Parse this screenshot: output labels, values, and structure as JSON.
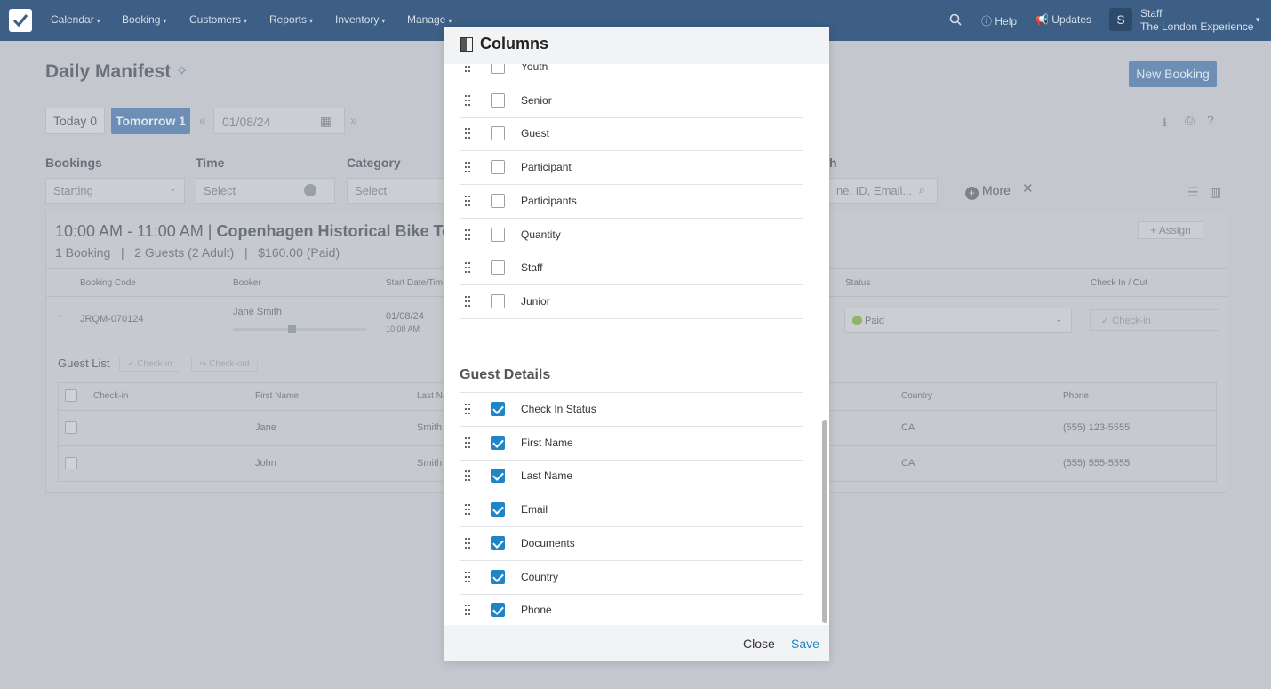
{
  "nav": {
    "items": [
      {
        "label": "Calendar"
      },
      {
        "label": "Booking"
      },
      {
        "label": "Customers"
      },
      {
        "label": "Reports"
      },
      {
        "label": "Inventory"
      },
      {
        "label": "Manage"
      }
    ],
    "help": "Help",
    "updates": "Updates",
    "avatar_initial": "S",
    "user_name": "Staff",
    "company": "The London Experience"
  },
  "page": {
    "title": "Daily Manifest",
    "new_booking": "New Booking",
    "today": "Today 0",
    "tomorrow": "Tomorrow 1",
    "date_value": "01/08/24"
  },
  "filters": {
    "bookings_label": "Bookings",
    "bookings_value": "Starting",
    "time_label": "Time",
    "time_placeholder": "Select",
    "category_label": "Category",
    "category_placeholder": "Select",
    "search_label_fragment": "h",
    "search_placeholder_fragment": "ne, ID, Email...",
    "more": "More"
  },
  "tour": {
    "time_range": "10:00 AM - 11:00 AM | ",
    "name": "Copenhagen Historical Bike Tour",
    "summary": "1 Booking   |   2 Guests (2 Adult)   |   $160.00 (Paid)",
    "assign": "Assign",
    "headers": {
      "booking_code": "Booking Code",
      "booker": "Booker",
      "start": "Start Date/Tim",
      "status": "Status",
      "check_in_out": "Check In / Out"
    },
    "row": {
      "code": "JRQM-070124",
      "booker": "Jane Smith",
      "start_date": "01/08/24",
      "start_time": "10:00 AM",
      "status": "Paid",
      "check_in": "Check-in"
    }
  },
  "guest_list": {
    "title": "Guest List",
    "check_in_btn": "Check-in",
    "check_out_btn": "Check-out",
    "headers": {
      "check_in": "Check-in",
      "first_name": "First Name",
      "last_name": "Last Na",
      "country": "Country",
      "phone": "Phone"
    },
    "rows": [
      {
        "first": "Jane",
        "last": "Smith",
        "country": "CA",
        "phone": "(555) 123-5555"
      },
      {
        "first": "John",
        "last": "Smith",
        "country": "CA",
        "phone": "(555) 555-5555"
      }
    ]
  },
  "modal": {
    "title": "Columns",
    "booking_columns": [
      {
        "label": "Youth",
        "checked": false
      },
      {
        "label": "Senior",
        "checked": false
      },
      {
        "label": "Guest",
        "checked": false
      },
      {
        "label": "Participant",
        "checked": false
      },
      {
        "label": "Participants",
        "checked": false
      },
      {
        "label": "Quantity",
        "checked": false
      },
      {
        "label": "Staff",
        "checked": false
      },
      {
        "label": "Junior",
        "checked": false
      }
    ],
    "guest_section_title": "Guest Details",
    "guest_columns": [
      {
        "label": "Check In Status",
        "checked": true
      },
      {
        "label": "First Name",
        "checked": true
      },
      {
        "label": "Last Name",
        "checked": true
      },
      {
        "label": "Email",
        "checked": true
      },
      {
        "label": "Documents",
        "checked": true
      },
      {
        "label": "Country",
        "checked": true
      },
      {
        "label": "Phone",
        "checked": true
      }
    ],
    "close": "Close",
    "save": "Save"
  }
}
